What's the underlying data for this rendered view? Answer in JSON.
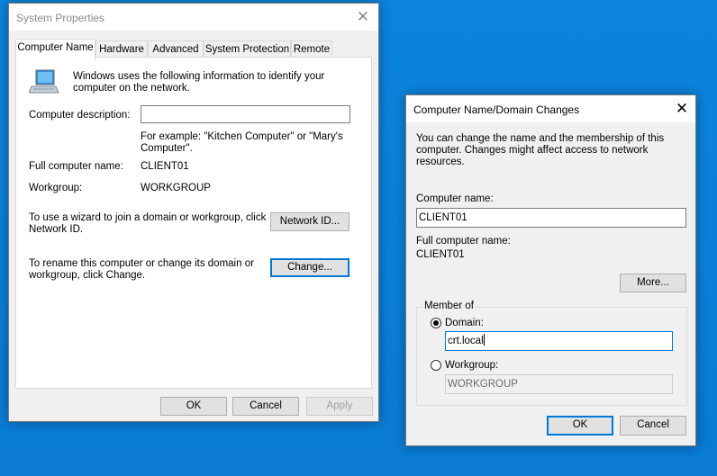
{
  "system_properties": {
    "title": "System Properties",
    "tabs": [
      "Computer Name",
      "Hardware",
      "Advanced",
      "System Protection",
      "Remote"
    ],
    "intro": "Windows uses the following information to identify your computer on the network.",
    "description_label": "Computer description:",
    "description_value": "",
    "example": "For example: \"Kitchen Computer\" or \"Mary's Computer\".",
    "full_name_label": "Full computer name:",
    "full_name_value": "CLIENT01",
    "workgroup_label": "Workgroup:",
    "workgroup_value": "WORKGROUP",
    "wizard_text": "To use a wizard to join a domain or workgroup, click Network ID.",
    "network_id_button": "Network ID...",
    "rename_text": "To rename this computer or change its domain or workgroup, click Change.",
    "change_button": "Change...",
    "ok_button": "OK",
    "cancel_button": "Cancel",
    "apply_button": "Apply"
  },
  "domain_changes": {
    "title": "Computer Name/Domain Changes",
    "intro": "You can change the name and the membership of this computer. Changes might affect access to network resources.",
    "computer_name_label": "Computer name:",
    "computer_name_value": "CLIENT01",
    "full_name_label": "Full computer name:",
    "full_name_value": "CLIENT01",
    "more_button": "More...",
    "member_of_label": "Member of",
    "domain_label": "Domain:",
    "domain_value": "crt.local",
    "workgroup_label": "Workgroup:",
    "workgroup_value": "WORKGROUP",
    "domain_selected": true,
    "ok_button": "OK",
    "cancel_button": "Cancel"
  }
}
